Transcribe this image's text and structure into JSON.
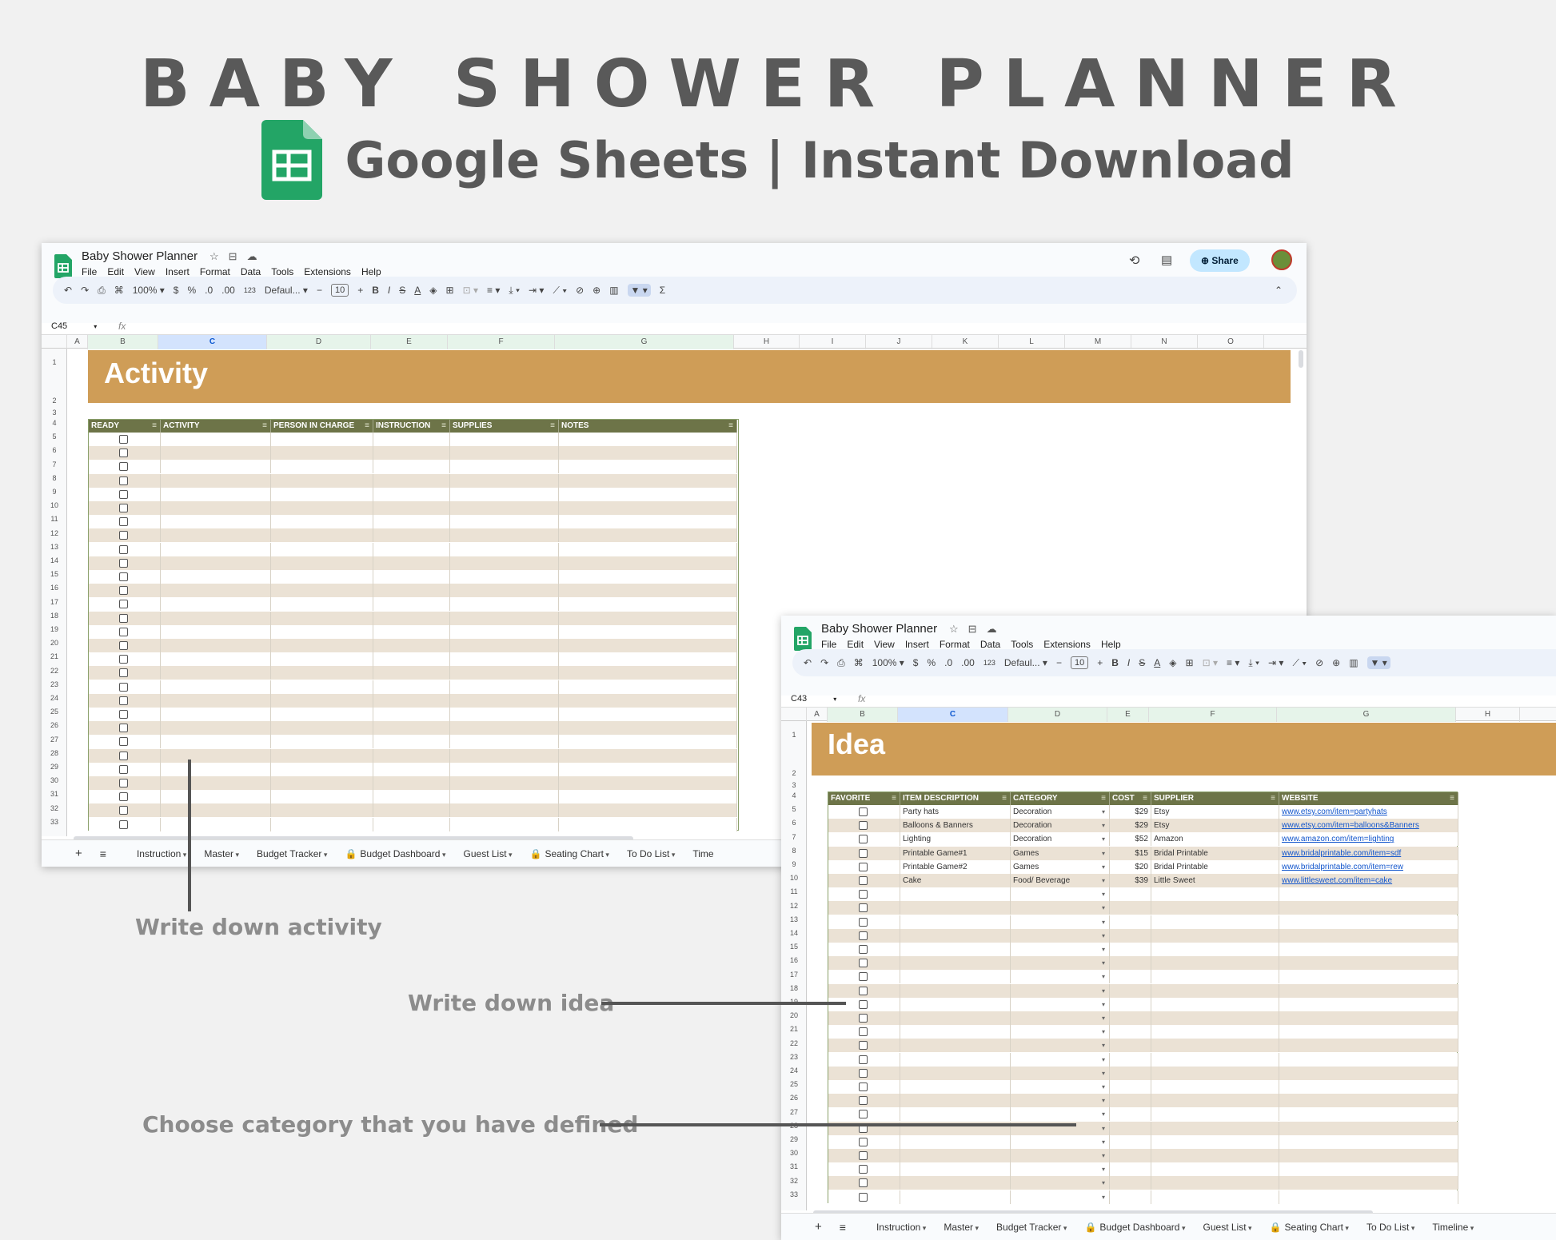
{
  "header": {
    "title": "BABY SHOWER PLANNER",
    "subtitle": "Google Sheets | Instant Download"
  },
  "app": {
    "doc_title": "Baby Shower Planner",
    "menu": [
      "File",
      "Edit",
      "View",
      "Insert",
      "Format",
      "Data",
      "Tools",
      "Extensions",
      "Help"
    ],
    "share_label": "Share",
    "zoom": "100%",
    "font": "Defaul...",
    "font_size": "10",
    "toolbar": {
      "currency": "$",
      "percent": "%",
      "dec_less": ".0",
      "dec_more": ".00",
      "format123": "123",
      "bold": "B",
      "italic": "I",
      "text_color": "A",
      "sigma": "Σ",
      "minus": "−",
      "plus": "+"
    }
  },
  "tabs": [
    "Instruction",
    "Master",
    "Budget Tracker",
    "Budget Dashboard",
    "Guest List",
    "Seating Chart",
    "To Do List",
    "Timeline"
  ],
  "locked_tabs": [
    "Budget Dashboard",
    "Seating Chart"
  ],
  "activity_sheet": {
    "name_box": "C45",
    "banner": "Activity",
    "columns": [
      "A",
      "B",
      "C",
      "D",
      "E",
      "F",
      "G",
      "H",
      "I",
      "J",
      "K",
      "L",
      "M",
      "N",
      "O"
    ],
    "headers": [
      "READY",
      "ACTIVITY",
      "PERSON IN CHARGE",
      "INSTRUCTION",
      "SUPPLIES",
      "NOTES"
    ],
    "rows_first": 1,
    "rows_last": 33,
    "tab_visible": "Time"
  },
  "idea_sheet": {
    "name_box": "C43",
    "banner": "Idea",
    "columns": [
      "A",
      "B",
      "C",
      "D",
      "E",
      "F",
      "G",
      "H"
    ],
    "headers": [
      "FAVORITE",
      "ITEM DESCRIPTION",
      "CATEGORY",
      "COST",
      "SUPPLIER",
      "WEBSITE"
    ],
    "items": [
      {
        "item": "Party hats",
        "category": "Decoration",
        "cost": "$29",
        "supplier": "Etsy",
        "website": "www.etsy.com/item=partyhats"
      },
      {
        "item": "Balloons & Banners",
        "category": "Decoration",
        "cost": "$29",
        "supplier": "Etsy",
        "website": "www.etsy.com/item=balloons&Banners"
      },
      {
        "item": "Lighting",
        "category": "Decoration",
        "cost": "$52",
        "supplier": "Amazon",
        "website": "www.amazon.com/item=lighting"
      },
      {
        "item": "Printable Game#1",
        "category": "Games",
        "cost": "$15",
        "supplier": "Bridal Printable",
        "website": "www.bridalprintable.com/item=sdf"
      },
      {
        "item": "Printable Game#2",
        "category": "Games",
        "cost": "$20",
        "supplier": "Bridal Printable",
        "website": "www.bridalprintable.com/item=rew"
      },
      {
        "item": "Cake",
        "category": "Food/ Beverage",
        "cost": "$39",
        "supplier": "Little Sweet",
        "website": "www.littlesweet.com/item=cake"
      }
    ]
  },
  "callouts": {
    "activity": "Write down activity",
    "idea": "Write down idea",
    "category": "Choose category that you have defined"
  }
}
